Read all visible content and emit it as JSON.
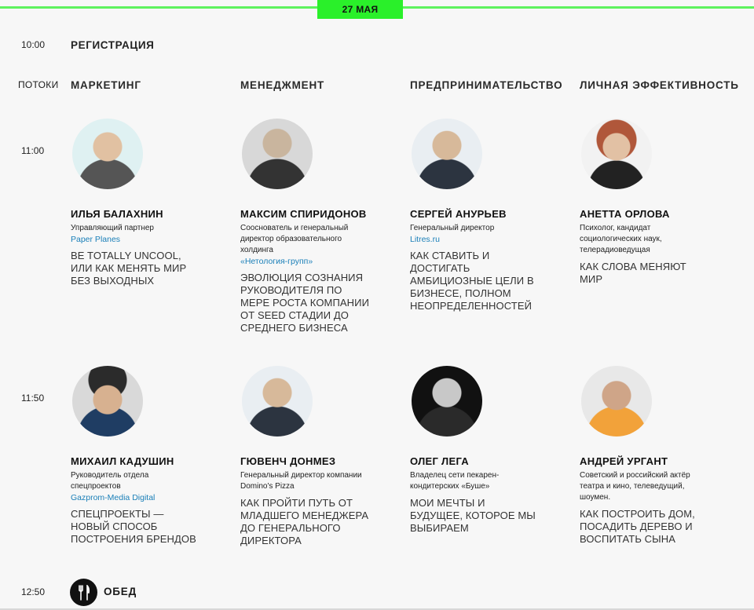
{
  "header": {
    "date": "27 МАЯ"
  },
  "schedule": {
    "reg_time": "10:00",
    "reg_label": "РЕГИСТРАЦИЯ",
    "streams_label": "ПОТОКИ",
    "streams": [
      "МАРКЕТИНГ",
      "МЕНЕДЖМЕНТ",
      "ПРЕДПРИНИМАТЕЛЬСТВО",
      "ЛИЧНАЯ ЭФФЕКТИВНОСТЬ"
    ],
    "slot1_time": "11:00",
    "slot2_time": "11:50",
    "lunch_time": "12:50",
    "lunch_label": "ОБЕД"
  },
  "slot1": [
    {
      "name": "ИЛЬЯ БАЛАХНИН",
      "role": "Управляющий партнер",
      "company": "Paper Planes",
      "topic": "BE TOTALLY UNCOOL, ИЛИ КАК МЕНЯТЬ МИР БЕЗ ВЫХОДНЫХ"
    },
    {
      "name": "МАКСИМ СПИРИДОНОВ",
      "role": "Сооснователь и генеральный директор образовательного холдинга",
      "company": "«Нетология-групп»",
      "topic": "ЭВОЛЮЦИЯ СОЗНАНИЯ РУКОВОДИТЕЛЯ ПО МЕРЕ РОСТА КОМПАНИИ ОТ SEED СТАДИИ ДО СРЕДНЕГО БИЗНЕСА"
    },
    {
      "name": "СЕРГЕЙ АНУРЬЕВ",
      "role": "Генеральный директор",
      "company": "Litres.ru",
      "topic": "КАК СТАВИТЬ И ДОСТИГАТЬ АМБИЦИОЗНЫЕ ЦЕЛИ В БИЗНЕСЕ, ПОЛНОМ НЕОПРЕДЕЛЕННОСТЕЙ"
    },
    {
      "name": "АНЕТТА ОРЛОВА",
      "role": "Психолог, кандидат социологических наук, телерадиоведущая",
      "company": "",
      "topic": "КАК СЛОВА МЕНЯЮТ МИР"
    }
  ],
  "slot2": [
    {
      "name": "МИХАИЛ КАДУШИН",
      "role": "Руководитель отдела спецпроектов",
      "company": "Gazprom-Media Digital",
      "topic": "СПЕЦПРОЕКТЫ — НОВЫЙ СПОСОБ ПОСТРОЕНИЯ БРЕНДОВ"
    },
    {
      "name": "ГЮВЕНЧ ДОНМЕЗ",
      "role": "Генеральный директор компании Domino's Pizza",
      "company": "",
      "topic": "КАК ПРОЙТИ ПУТЬ ОТ МЛАДШЕГО МЕНЕДЖЕРА ДО ГЕНЕРАЛЬНОГО ДИРЕКТОРА"
    },
    {
      "name": "ОЛЕГ ЛЕГА",
      "role": "Владелец сети пекарен-кондитерских «Буше»",
      "company": "",
      "topic": "МОИ МЕЧТЫ И БУДУЩЕЕ, КОТОРОЕ МЫ ВЫБИРАЕМ"
    },
    {
      "name": "АНДРЕЙ УРГАНТ",
      "role": "Советский и российский актёр театра и кино, телеведущий, шоумен.",
      "company": "",
      "topic": "КАК ПОСТРОИТЬ ДОМ, ПОСАДИТЬ ДЕРЕВО И ВОСПИТАТЬ СЫНА"
    }
  ]
}
